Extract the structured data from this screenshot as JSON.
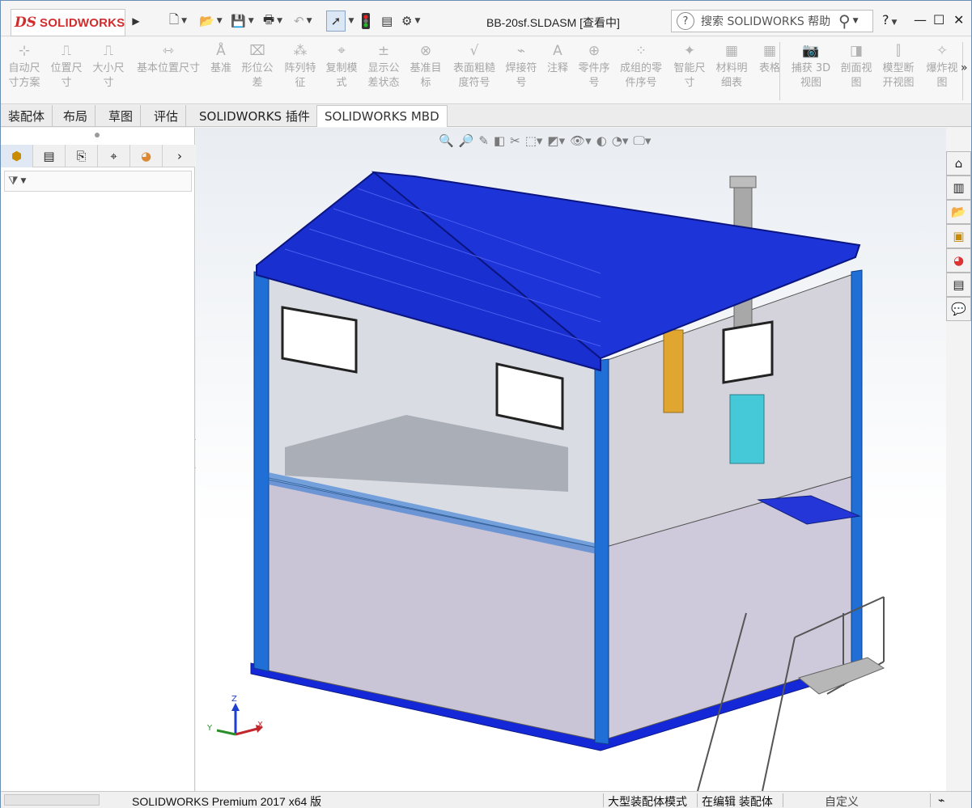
{
  "app": {
    "brand": "SOLIDWORKS",
    "brand_mark": "DS"
  },
  "titlebar": {
    "document_title": "BB-20sf.SLDASM [查看中]",
    "search_placeholder": "搜索 SOLIDWORKS 帮助",
    "help_label": "?"
  },
  "ribbon": {
    "items": [
      {
        "label": "自动尺\n寸方案",
        "icon": "auto-dimension-icon"
      },
      {
        "label": "位置尺\n寸",
        "icon": "location-dimension-icon"
      },
      {
        "label": "大小尺\n寸",
        "icon": "size-dimension-icon"
      },
      {
        "label": "基本位置尺寸",
        "icon": "basic-location-icon"
      },
      {
        "label": "基准",
        "icon": "datum-icon"
      },
      {
        "label": "形位公\n差",
        "icon": "geometric-tolerance-icon"
      },
      {
        "label": "阵列特\n征",
        "icon": "pattern-feature-icon"
      },
      {
        "label": "复制模\n式",
        "icon": "copy-scheme-icon"
      },
      {
        "label": "显示公\n差状态",
        "icon": "show-tolerance-status-icon"
      },
      {
        "label": "基准目\n标",
        "icon": "datum-target-icon"
      },
      {
        "label": "表面粗糙\n度符号",
        "icon": "surface-finish-icon"
      },
      {
        "label": "焊接符\n号",
        "icon": "weld-symbol-icon"
      },
      {
        "label": "注释",
        "icon": "note-icon"
      },
      {
        "label": "零件序\n号",
        "icon": "balloon-icon"
      },
      {
        "label": "成组的零\n件序号",
        "icon": "stacked-balloon-icon"
      },
      {
        "label": "智能尺\n寸",
        "icon": "smart-dimension-icon"
      },
      {
        "label": "材料明\n细表",
        "icon": "bom-icon"
      },
      {
        "label": "表格",
        "icon": "table-icon"
      },
      {
        "label": "捕获 3D\n视图",
        "icon": "capture-3d-view-icon"
      },
      {
        "label": "剖面视\n图",
        "icon": "section-view-icon"
      },
      {
        "label": "模型断\n开视图",
        "icon": "model-break-view-icon"
      },
      {
        "label": "爆炸视\n图",
        "icon": "exploded-view-icon"
      }
    ]
  },
  "tabs": [
    "装配体",
    "布局",
    "草图",
    "评估",
    "SOLIDWORKS 插件",
    "SOLIDWORKS MBD"
  ],
  "active_tab": "SOLIDWORKS MBD",
  "status": {
    "product": "SOLIDWORKS Premium 2017 x64 版",
    "mode": "大型装配体模式",
    "editing": "在编辑 装配体",
    "custom": "自定义"
  },
  "triad": {
    "x": "X",
    "y": "Y",
    "z": "Z"
  },
  "colors": {
    "accent_red": "#d22d2d",
    "frame_blue": "#1f6fd6",
    "roof_blue": "#1a2fd0"
  }
}
